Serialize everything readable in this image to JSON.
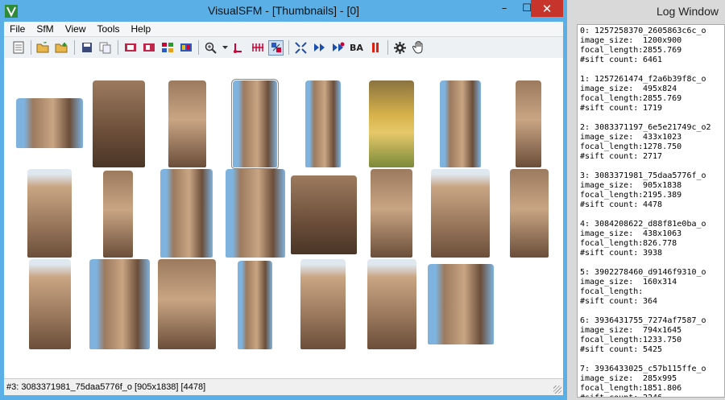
{
  "window": {
    "title": "VisualSFM - [Thumbnails] - [0]",
    "controls": [
      "–",
      "☐",
      "✕"
    ]
  },
  "menu": [
    "File",
    "SfM",
    "View",
    "Tools",
    "Help"
  ],
  "toolbar": {
    "text_buttons": {
      "ba": "BA"
    }
  },
  "status": {
    "text": "#3: 3083371981_75daa5776f_o [905x1838] [4478]"
  },
  "log_window": {
    "title": "Log Window",
    "labels": {
      "image_size": "image_size:",
      "focal_length": "focal_length:",
      "sift_count": "#sift count:"
    },
    "entries": [
      {
        "header": "0: 1257258370_2605863c6c_o",
        "image_size": "1200x900",
        "focal_length": "2855.769",
        "sift_count": "6461"
      },
      {
        "header": "1: 1257261474_f2a6b39f8c_o",
        "image_size": "495x824",
        "focal_length": "2855.769",
        "sift_count": "1719"
      },
      {
        "header": "2: 3083371197_6e5e21749c_o2",
        "image_size": "433x1023",
        "focal_length": "1278.750",
        "sift_count": "2717"
      },
      {
        "header": "3: 3083371981_75daa5776f_o",
        "image_size": "905x1838",
        "focal_length": "2195.389",
        "sift_count": "4478"
      },
      {
        "header": "4: 3084208622_d88f81e0ba_o",
        "image_size": "438x1063",
        "focal_length": "826.778",
        "sift_count": "3938"
      },
      {
        "header": "5: 3902278460_d9146f9310_o",
        "image_size": "160x314",
        "focal_length": "",
        "sift_count": "364"
      },
      {
        "header": "6: 3936431755_7274af7587_o",
        "image_size": "794x1645",
        "focal_length": "1233.750",
        "sift_count": "5425"
      },
      {
        "header": "7: 3936433025_c57b115ffe_o",
        "image_size": "285x995",
        "focal_length": "1851.806",
        "sift_count": "2246"
      }
    ]
  },
  "colors": {
    "titlebar": "#5ab0e6",
    "close_button": "#c7342b",
    "rock_dark": "#6b4e3a",
    "rock_mid": "#9c7a5e",
    "rock_light": "#c9a583",
    "sky": "#7fb3df",
    "golden": "#d7b24a"
  },
  "thumbnails": [
    {
      "style": "sky"
    },
    {
      "style": "dark"
    },
    {
      "style": "mid"
    },
    {
      "style": "sky",
      "selected": true
    },
    {
      "style": "sky"
    },
    {
      "style": "golden"
    },
    {
      "style": "sky"
    },
    {
      "style": "mid"
    },
    {
      "style": "light"
    },
    {
      "style": "mid"
    },
    {
      "style": "sky"
    },
    {
      "style": "sky"
    },
    {
      "style": "dark"
    },
    {
      "style": "mid"
    },
    {
      "style": "light"
    },
    {
      "style": "mid"
    },
    {
      "style": "light"
    },
    {
      "style": "sky"
    },
    {
      "style": "mid"
    },
    {
      "style": "sky"
    },
    {
      "style": "light"
    },
    {
      "style": "light"
    },
    {
      "style": "sky"
    }
  ]
}
